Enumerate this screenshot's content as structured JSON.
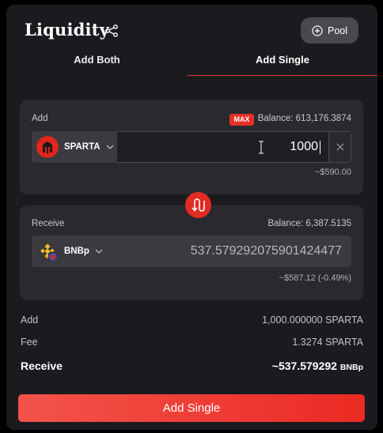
{
  "header": {
    "title": "Liquidity",
    "pool_button_label": "Pool"
  },
  "tabs": [
    {
      "label": "Add Both",
      "active": false
    },
    {
      "label": "Add Single",
      "active": true
    }
  ],
  "add_panel": {
    "label": "Add",
    "max_label": "MAX",
    "balance_text": "Balance: 613,176.3874",
    "token": {
      "symbol": "SPARTA",
      "icon": "sparta-helmet-icon"
    },
    "amount": "1000",
    "usd_value": "~$590.00"
  },
  "receive_panel": {
    "label": "Receive",
    "balance_text": "Balance: 6,387.5135",
    "token": {
      "symbol": "BNBp",
      "icon": "bnb-pool-icon"
    },
    "amount": "537.579292075901424477",
    "usd_value": "~$587.12 (-0.49%)"
  },
  "summary": {
    "add": {
      "label": "Add",
      "value": "1,000.000000 SPARTA"
    },
    "fee": {
      "label": "Fee",
      "value": "1.3274 SPARTA"
    },
    "receive": {
      "label": "Receive",
      "value": "~537.579292",
      "unit": "BNBp"
    }
  },
  "primary_action": {
    "label": "Add Single"
  },
  "colors": {
    "accent": "#e5362c",
    "card_bg": "#1b1a1f",
    "panel_bg": "#2a2930",
    "button_gradient_start": "#f3534a",
    "button_gradient_end": "#ea2a23"
  }
}
